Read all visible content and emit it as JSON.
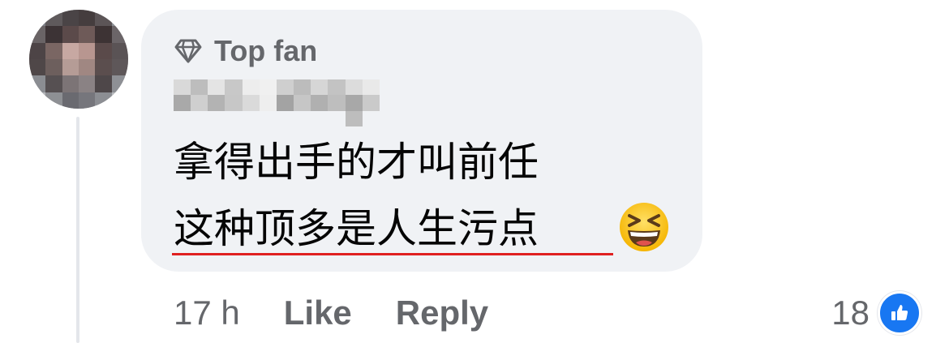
{
  "comment": {
    "badge_label": "Top fan",
    "line1": "拿得出手的才叫前任",
    "line2": "这种顶多是人生污点",
    "emoji_icon": "grinning-squinting-face-icon",
    "underline_color": "#e02020"
  },
  "actions": {
    "timestamp": "17 h",
    "like_label": "Like",
    "reply_label": "Reply"
  },
  "reactions": {
    "count": "18",
    "icon": "like-thumb-icon",
    "color": "#1877f2"
  },
  "colors": {
    "bubble": "#f0f2f5",
    "secondary_text": "#65676b",
    "primary_text": "#050505"
  }
}
